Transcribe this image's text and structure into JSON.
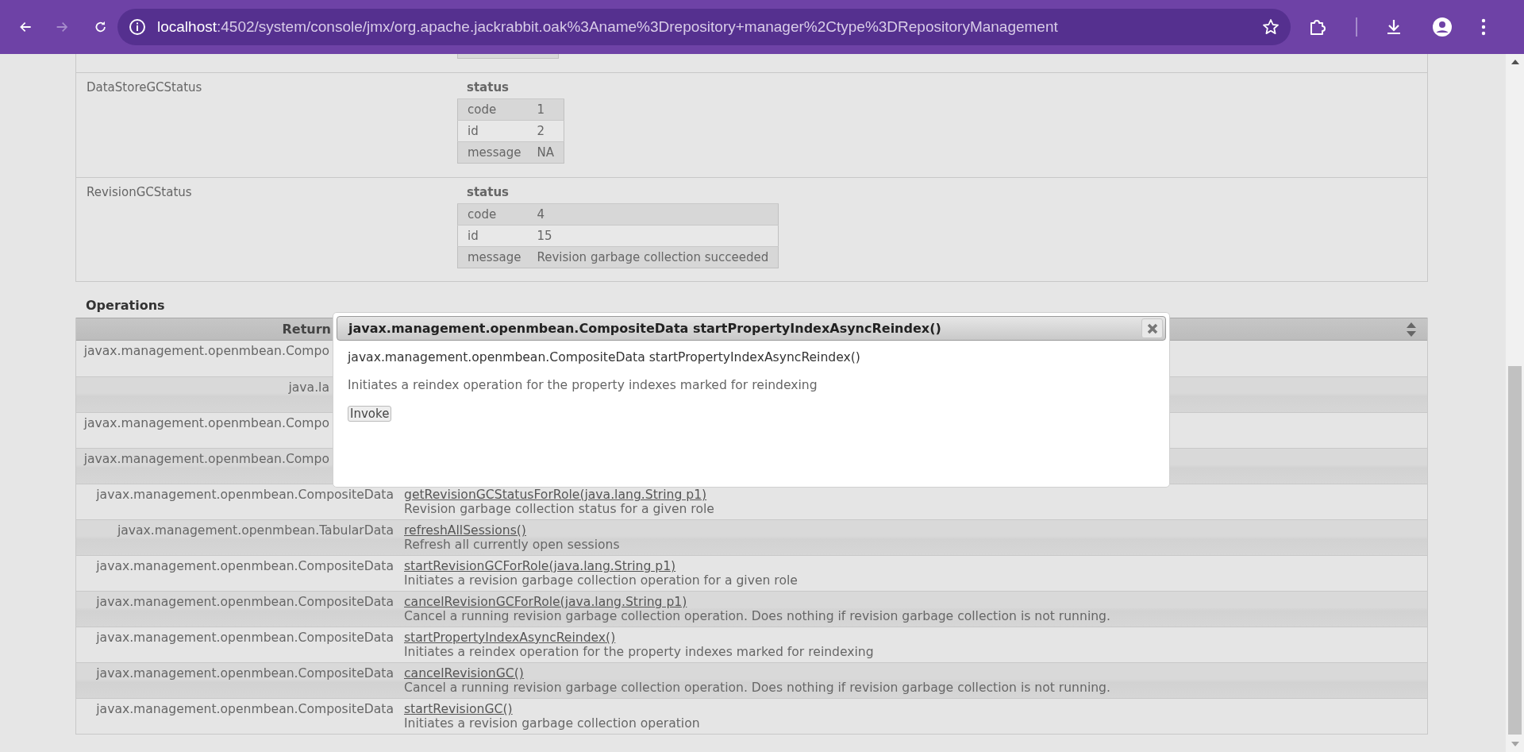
{
  "browser": {
    "nav": [
      {
        "kind": "back",
        "disabled": false
      },
      {
        "kind": "forward",
        "disabled": true
      },
      {
        "kind": "reload",
        "disabled": false
      }
    ],
    "host": "localhost",
    "path": ":4502/system/console/jmx/org.apache.jackrabbit.oak%3Aname%3Drepository+manager%2Ctype%3DRepositoryManagement"
  },
  "attributes": [
    {
      "name": "DataStoreGCStatus",
      "value_title": "status",
      "fields": [
        {
          "key": "code",
          "value": "1"
        },
        {
          "key": "id",
          "value": "2"
        },
        {
          "key": "message",
          "value": "NA"
        }
      ]
    },
    {
      "name": "RevisionGCStatus",
      "value_title": "status",
      "fields": [
        {
          "key": "code",
          "value": "4"
        },
        {
          "key": "id",
          "value": "15"
        },
        {
          "key": "message",
          "value": "Revision garbage collection succeeded"
        }
      ]
    }
  ],
  "operations": {
    "title": "Operations",
    "columns": [
      "Return"
    ],
    "rows": [
      {
        "return": "javax.management.openmbean.Compo"
      },
      {
        "return": "java.la"
      },
      {
        "return": "javax.management.openmbean.Compo"
      },
      {
        "return": "javax.management.openmbean.Compo"
      },
      {
        "return": "javax.management.openmbean.CompositeData",
        "name": "getRevisionGCStatusForRole(java.lang.String p1)",
        "description": "Revision garbage collection status for a given role"
      },
      {
        "return": "javax.management.openmbean.TabularData",
        "name": "refreshAllSessions()",
        "description": "Refresh all currently open sessions"
      },
      {
        "return": "javax.management.openmbean.CompositeData",
        "name": "startRevisionGCForRole(java.lang.String p1)",
        "description": "Initiates a revision garbage collection operation for a given role"
      },
      {
        "return": "javax.management.openmbean.CompositeData",
        "name": "cancelRevisionGCForRole(java.lang.String p1)",
        "description": "Cancel a running revision garbage collection operation. Does nothing if revision garbage collection is not running."
      },
      {
        "return": "javax.management.openmbean.CompositeData",
        "name": "startPropertyIndexAsyncReindex()",
        "description": "Initiates a reindex operation for the property indexes marked for reindexing"
      },
      {
        "return": "javax.management.openmbean.CompositeData",
        "name": "cancelRevisionGC()",
        "description": "Cancel a running revision garbage collection operation. Does nothing if revision garbage collection is not running."
      },
      {
        "return": "javax.management.openmbean.CompositeData",
        "name": "startRevisionGC()",
        "description": "Initiates a revision garbage collection operation"
      }
    ]
  },
  "dialog": {
    "title": "javax.management.openmbean.CompositeData startPropertyIndexAsyncReindex()",
    "signature": "javax.management.openmbean.CompositeData startPropertyIndexAsyncReindex()",
    "description": "Initiates a reindex operation for the property indexes marked for reindexing",
    "button": "Invoke"
  }
}
